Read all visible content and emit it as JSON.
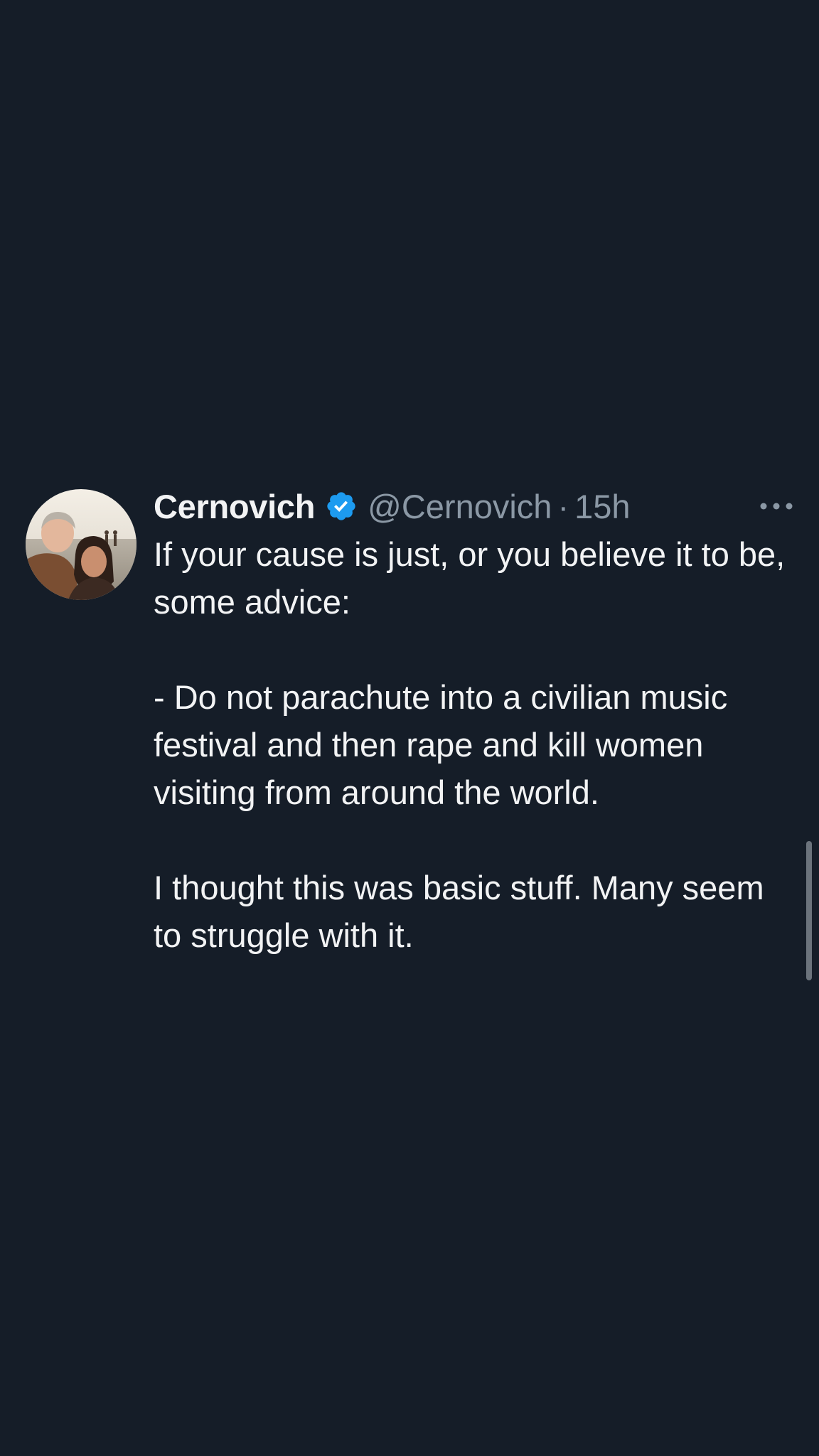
{
  "tweet": {
    "display_name": "Cernovich",
    "handle": "@Cernovich",
    "separator": "·",
    "timestamp": "15h",
    "text": "If your cause is just, or you believe it to be, some advice:\n\n- Do not parachute into a civilian music festival and then rape and kill women visiting from around the world.\n\nI thought this was basic stuff. Many seem to struggle with it.",
    "icons": {
      "verified": "verified-badge-icon",
      "more": "more-options-icon"
    }
  },
  "colors": {
    "background": "#151d28",
    "text": "#f2f3f4",
    "secondary_text": "#8b98a5",
    "verified": "#1d9bf0"
  }
}
